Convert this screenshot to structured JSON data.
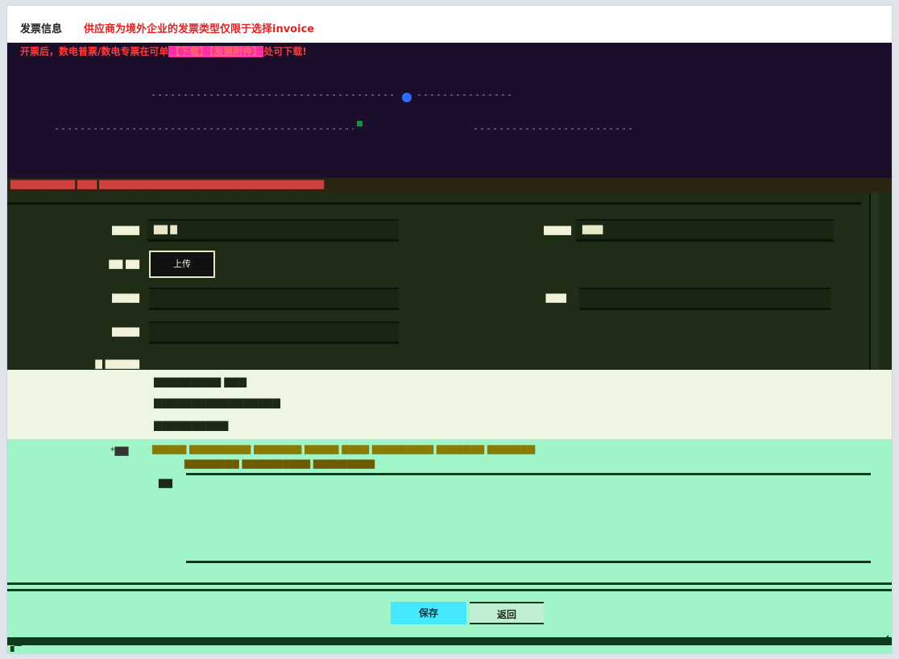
{
  "header": {
    "title": "发票信息",
    "warning": "供应商为境外企业的发票类型仅限于选择invoice"
  },
  "notice": {
    "prefix": "开票后，数电普票/数电专票在可单",
    "highlight": "【下载】【发票附件】",
    "suffix": "处可下载!"
  },
  "form": {
    "upload_button": "上传"
  },
  "actions": {
    "submit_label": "保存",
    "cancel_label": "返回"
  },
  "colors": {
    "warning": "#e42020",
    "accent": "#2e6bff",
    "primary_button": "#46e8ff"
  }
}
